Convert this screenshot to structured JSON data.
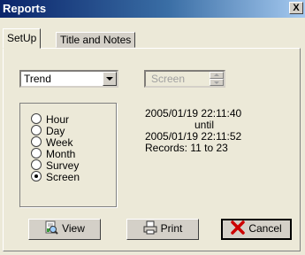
{
  "window": {
    "title": "Reports",
    "close_label": "X"
  },
  "tabs": [
    {
      "label": "SetUp",
      "active": true
    },
    {
      "label": "Title and Notes",
      "active": false
    }
  ],
  "type_select": {
    "value": "Trend"
  },
  "mode_field": {
    "value": "Screen"
  },
  "period_options": [
    {
      "label": "Hour",
      "checked": false
    },
    {
      "label": "Day",
      "checked": false
    },
    {
      "label": "Week",
      "checked": false
    },
    {
      "label": "Month",
      "checked": false
    },
    {
      "label": "Survey",
      "checked": false
    },
    {
      "label": "Screen",
      "checked": true
    }
  ],
  "info": {
    "start": "2005/01/19 22:11:40",
    "until": "until",
    "end": "2005/01/19 22:11:52",
    "records": "Records: 11 to 23"
  },
  "buttons": {
    "view": "View",
    "print": "Print",
    "cancel": "Cancel"
  },
  "colors": {
    "titlebar": "#0a246a",
    "face": "#ece9d8",
    "cancel_icon": "#cc0000"
  }
}
